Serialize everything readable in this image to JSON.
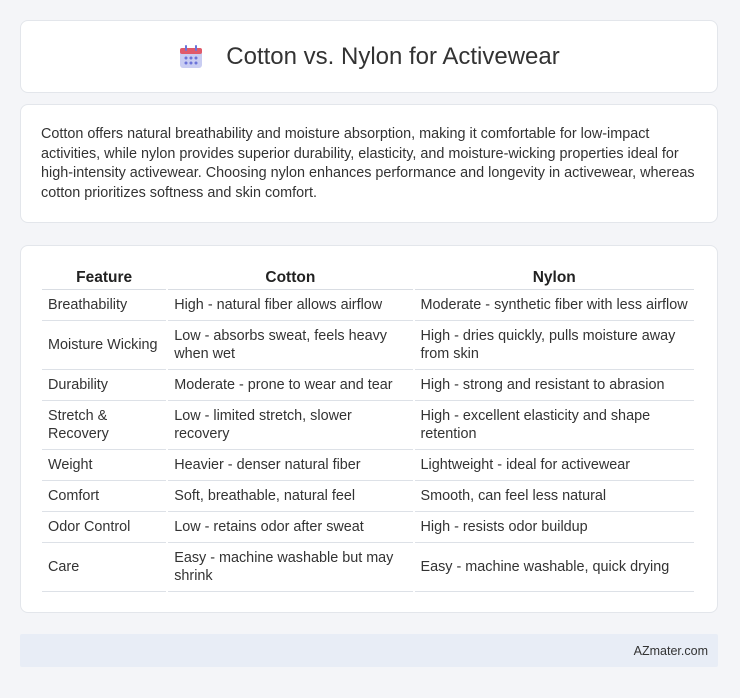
{
  "header": {
    "title": "Cotton vs. Nylon for Activewear",
    "icon": "calendar-icon",
    "icon_colors": {
      "top": "#e05a6a",
      "body": "#c9cdf2",
      "dots": "#6b73d9"
    }
  },
  "summary": {
    "text": "Cotton offers natural breathability and moisture absorption, making it comfortable for low-impact activities, while nylon provides superior durability, elasticity, and moisture-wicking properties ideal for high-intensity activewear. Choosing nylon enhances performance and longevity in activewear, whereas cotton prioritizes softness and skin comfort."
  },
  "table": {
    "headers": [
      "Feature",
      "Cotton",
      "Nylon"
    ],
    "rows": [
      [
        "Breathability",
        "High - natural fiber allows airflow",
        "Moderate - synthetic fiber with less airflow"
      ],
      [
        "Moisture Wicking",
        "Low - absorbs sweat, feels heavy when wet",
        "High - dries quickly, pulls moisture away from skin"
      ],
      [
        "Durability",
        "Moderate - prone to wear and tear",
        "High - strong and resistant to abrasion"
      ],
      [
        "Stretch & Recovery",
        "Low - limited stretch, slower recovery",
        "High - excellent elasticity and shape retention"
      ],
      [
        "Weight",
        "Heavier - denser natural fiber",
        "Lightweight - ideal for activewear"
      ],
      [
        "Comfort",
        "Soft, breathable, natural feel",
        "Smooth, can feel less natural"
      ],
      [
        "Odor Control",
        "Low - retains odor after sweat",
        "High - resists odor buildup"
      ],
      [
        "Care",
        "Easy - machine washable but may shrink",
        "Easy - machine washable, quick drying"
      ]
    ]
  },
  "footer": {
    "text": "AZmater.com"
  }
}
